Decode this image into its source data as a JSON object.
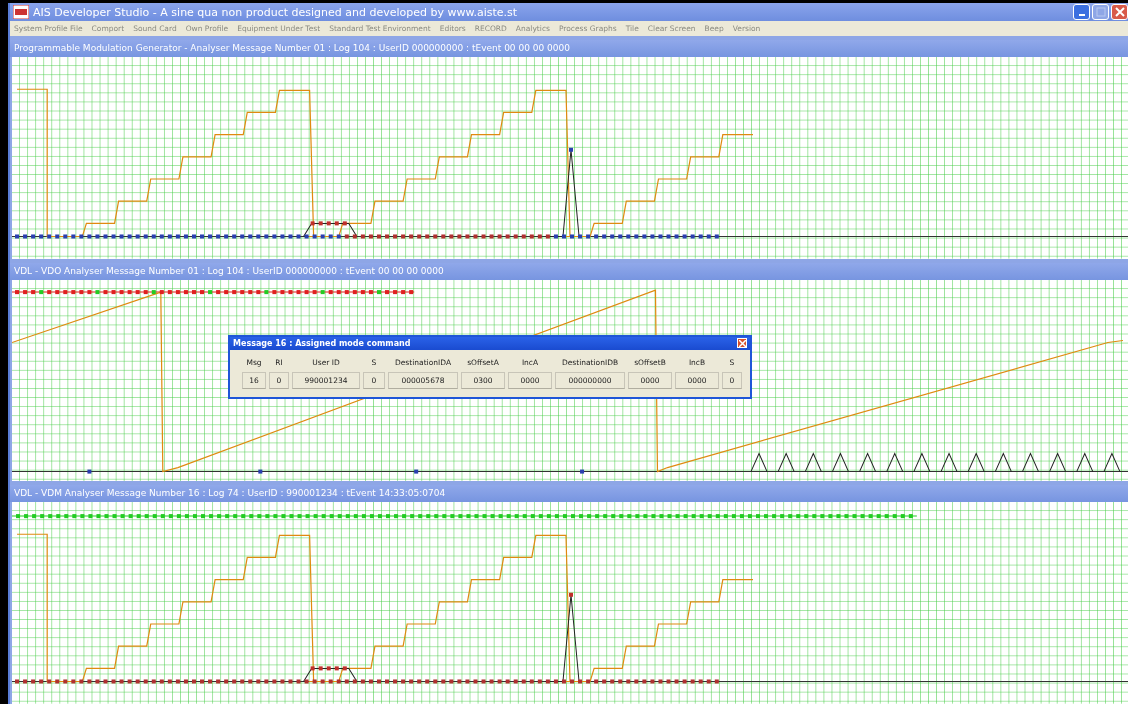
{
  "window": {
    "title": "AIS Developer Studio - A sine qua non product designed and developed by www.aiste.st"
  },
  "menu": [
    "System Profile File",
    "Comport",
    "Sound Card",
    "Own Profile",
    "Equipment Under Test",
    "Standard Test Environment",
    "Editors",
    "RECORD",
    "Analytics",
    "Process Graphs",
    "Tile",
    "Clear Screen",
    "Beep",
    "Version"
  ],
  "panels": [
    {
      "title": "Programmable Modulation Generator - Analyser Message Number 01 : Log 104 : UserID 000000000 : tEvent 00 00 00 0000",
      "kind": "staircase"
    },
    {
      "title": "VDL - VDO Analyser Message Number 01 : Log 104 : UserID 000000000 : tEvent 00 00 00 0000",
      "kind": "ramp"
    },
    {
      "title": "VDL - VDM Analyser Message Number 16 : Log 74 : UserID : 990001234 : tEvent 14:33:05:0704",
      "kind": "staircase"
    }
  ],
  "dialog": {
    "title": "Message 16 : Assigned mode command",
    "columns": [
      "Msg",
      "RI",
      "User ID",
      "S",
      "DestinationIDA",
      "sOffsetA",
      "IncA",
      "DestinationIDB",
      "sOffsetB",
      "IncB",
      "S"
    ],
    "values": [
      "16",
      "0",
      "990001234",
      "0",
      "000005678",
      "0300",
      "0000",
      "000000000",
      "0000",
      "0000",
      "0"
    ]
  }
}
